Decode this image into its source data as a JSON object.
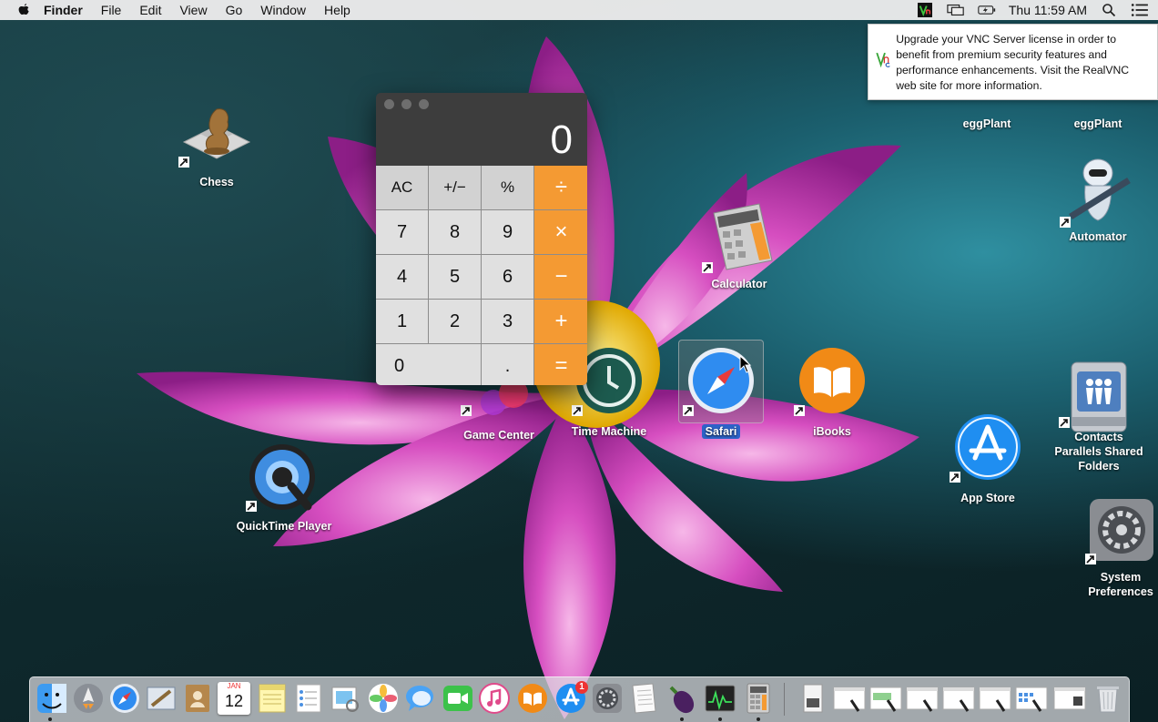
{
  "menubar": {
    "app_name": "Finder",
    "items": [
      "File",
      "Edit",
      "View",
      "Go",
      "Window",
      "Help"
    ],
    "clock": "Thu 11:59 AM",
    "status_icons": [
      "vnc-icon",
      "display-mirroring-icon",
      "battery-charging-icon",
      "spotlight-search-icon",
      "notification-center-icon"
    ]
  },
  "vnc_notice": {
    "text": "Upgrade your VNC Server license in order to benefit from premium security features and performance enhancements. Visit the RealVNC web site for more information."
  },
  "calculator": {
    "display": "0",
    "keys": [
      [
        "AC",
        "+/−",
        "%",
        "÷"
      ],
      [
        "7",
        "8",
        "9",
        "×"
      ],
      [
        "4",
        "5",
        "6",
        "−"
      ],
      [
        "1",
        "2",
        "3",
        "+"
      ],
      [
        "0",
        ".",
        "="
      ]
    ]
  },
  "desktop_icons": {
    "chess": "Chess",
    "eggplant1": "eggPlant",
    "eggplant2": "eggPlant",
    "automator": "Automator",
    "calculator": "Calculator",
    "game_center": "Game Center",
    "time_machine": "Time Machine",
    "safari": "Safari",
    "ibooks": "iBooks",
    "contacts_shared": "Contacts Parallels Shared Folders",
    "app_store": "App Store",
    "quicktime": "QuickTime Player",
    "system_prefs": "System Preferences"
  },
  "dock": {
    "calendar_month": "JAN",
    "calendar_day": "12",
    "app_store_badge": "1",
    "items": [
      "finder-icon",
      "launchpad-icon",
      "safari-icon",
      "mail-icon",
      "contacts-icon",
      "calendar-icon",
      "notes-icon",
      "reminders-icon",
      "preview-icon",
      "photos-icon",
      "messages-icon",
      "facetime-icon",
      "itunes-icon",
      "ibooks-icon",
      "app-store-icon",
      "system-preferences-icon",
      "textedit-icon",
      "eggplant-icon",
      "activity-monitor-icon",
      "calculator-icon"
    ]
  },
  "colors": {
    "accent_orange": "#f49a33",
    "selection_blue": "#2d63c8"
  }
}
